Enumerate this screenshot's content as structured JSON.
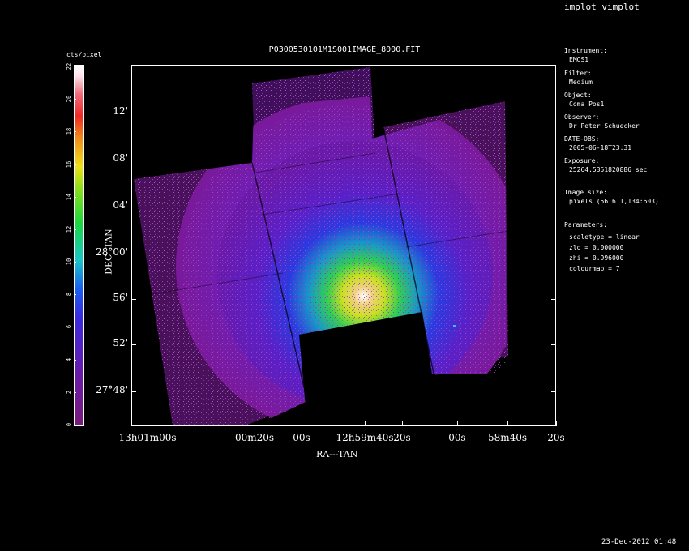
{
  "header": {
    "app_title": "implot vimplot",
    "plot_title": "P0300530101M1S001IMAGE_8000.FIT"
  },
  "colorbar": {
    "label": "cts/pixel",
    "ticks": [
      "0",
      "2",
      "4",
      "6",
      "8",
      "10",
      "12",
      "14",
      "16",
      "18",
      "20",
      "22"
    ]
  },
  "axes": {
    "x_label": "RA---TAN",
    "y_label": "DEC--TAN",
    "y_ticks": [
      "12'",
      "08'",
      "04'",
      "28°00'",
      "56'",
      "52'",
      "27°48'"
    ],
    "x_ticks": [
      "13h01m00s",
      "00m20s",
      "00s",
      "12h59m40s",
      "20s",
      "00s",
      "58m40s",
      "20s"
    ]
  },
  "info": {
    "instrument_label": "Instrument:",
    "instrument": "EMOS1",
    "filter_label": "Filter:",
    "filter": "Medium",
    "object_label": "Object:",
    "object": "Coma Pos1",
    "observer_label": "Observer:",
    "observer": "Dr Peter Schuecker",
    "date_label": "DATE-OBS:",
    "date": "2005-06-18T23:31",
    "exposure_label": "Exposure:",
    "exposure": "25264.5351820886 sec",
    "image_size_label": "Image size:",
    "image_size": "pixels (56:611,134:603)",
    "parameters_label": "Parameters:",
    "scaletype": "scaletype = linear",
    "zlo": "zlo = 0.000000",
    "zhi": "zhi = 0.996000",
    "colourmap": "colourmap =   7"
  },
  "footer": {
    "timestamp": "23-Dec-2012 01:48"
  }
}
